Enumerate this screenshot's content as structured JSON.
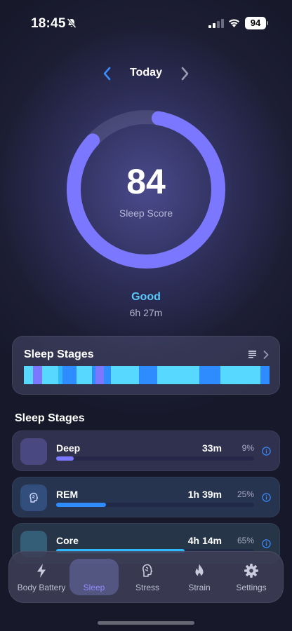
{
  "status_bar": {
    "time": "18:45",
    "battery_level": "94"
  },
  "date_nav": {
    "title": "Today"
  },
  "sleep_score": {
    "value": "84",
    "label": "Sleep Score",
    "fraction": 0.84,
    "rating": "Good",
    "duration": "6h 27m"
  },
  "stages_card": {
    "title": "Sleep Stages"
  },
  "stages_section": {
    "title": "Sleep Stages",
    "items": [
      {
        "name": "Deep",
        "duration": "33m",
        "percent": "9%",
        "fraction": 0.09,
        "color": "#7b78ff"
      },
      {
        "name": "REM",
        "duration": "1h 39m",
        "percent": "25%",
        "fraction": 0.25,
        "color": "#2f8cff"
      },
      {
        "name": "Core",
        "duration": "4h 14m",
        "percent": "65%",
        "fraction": 0.65,
        "color": "#2fb8ff"
      }
    ]
  },
  "colors": {
    "accent": "#7b78ff",
    "rating": "#5ac8fa",
    "deep": "#7b78ff",
    "rem": "#2f8cff",
    "core": "#2fb8ff",
    "light": "#56d8ff"
  },
  "tab_bar": {
    "tabs": [
      {
        "label": "Body Battery",
        "icon": "bolt-icon"
      },
      {
        "label": "Sleep",
        "icon": "moon-icon",
        "active": true
      },
      {
        "label": "Stress",
        "icon": "brain-head-icon"
      },
      {
        "label": "Strain",
        "icon": "flame-icon"
      },
      {
        "label": "Settings",
        "icon": "gear-icon"
      }
    ]
  }
}
